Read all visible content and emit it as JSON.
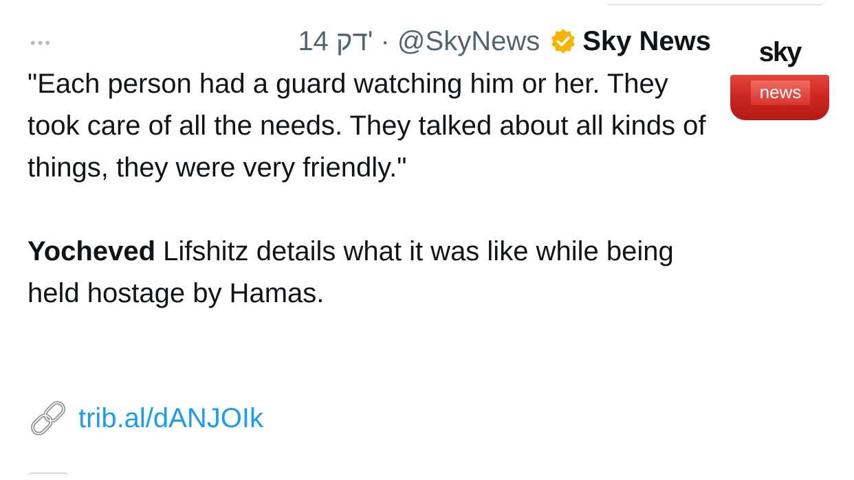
{
  "tweet": {
    "more_icon": "ellipsis-icon",
    "author": {
      "name": "Sky News",
      "handle": "@SkyNews",
      "verified_badge_color": "#f4b400",
      "verified_icon": "verified-badge-icon"
    },
    "separator": "·",
    "time": "14 דק'",
    "quote": "\"Each person had a guard watching him or her. They took care of all the needs. They talked about all kinds of things, they were very friendly.\"",
    "detail_bold": "Yocheved",
    "detail_rest": " Lifshitz details what it was like while being held hostage by Hamas.",
    "link_icon": "link-icon",
    "link_text": "trib.al/dANJOIk",
    "link_color": "#1d9bf0"
  },
  "avatar": {
    "logo_top": "sky",
    "logo_bottom": "news",
    "brand_color": "#c8241e"
  }
}
